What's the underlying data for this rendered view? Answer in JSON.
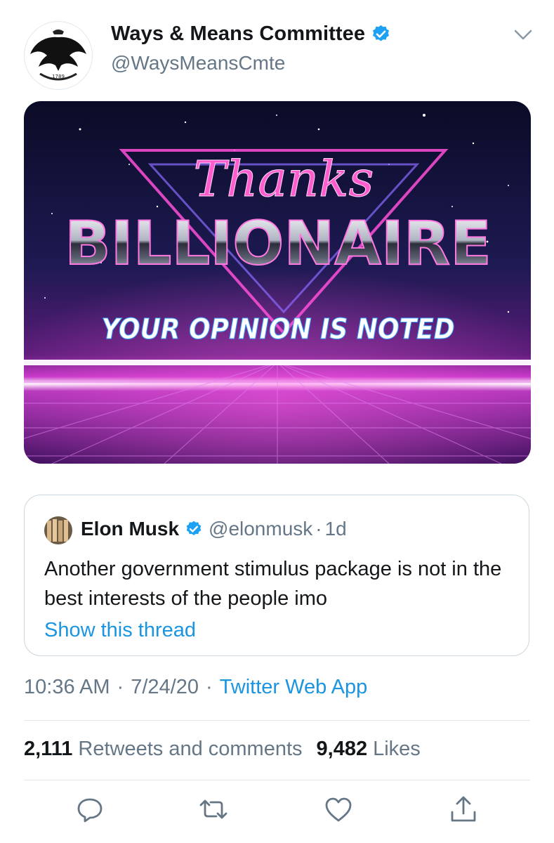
{
  "author": {
    "name": "Ways & Means Committee",
    "handle": "@WaysMeansCmte",
    "avatar_icon": "eagle-seal",
    "avatar_year": "1789",
    "verified": true
  },
  "image": {
    "line1": "Thanks",
    "line2": "BILLIONAIRE",
    "line3": "YOUR OPINION IS NOTED"
  },
  "quoted_tweet": {
    "name": "Elon Musk",
    "handle": "@elonmusk",
    "separator": "·",
    "time": "1d",
    "text": "Another government stimulus package is not in the best interests of the people imo",
    "show_thread": "Show this thread",
    "verified": true
  },
  "meta": {
    "time": "10:36 AM",
    "dot1": "·",
    "date": "7/24/20",
    "dot2": "·",
    "source": "Twitter Web App"
  },
  "stats": {
    "retweets_count": "2,111",
    "retweets_label": "Retweets and comments",
    "likes_count": "9,482",
    "likes_label": "Likes"
  },
  "colors": {
    "verified": "#1da1f2",
    "link": "#1b95e0",
    "muted": "#657786",
    "divider": "#e1e8ed"
  },
  "actions": [
    "reply-icon",
    "retweet-icon",
    "like-icon",
    "share-icon"
  ]
}
